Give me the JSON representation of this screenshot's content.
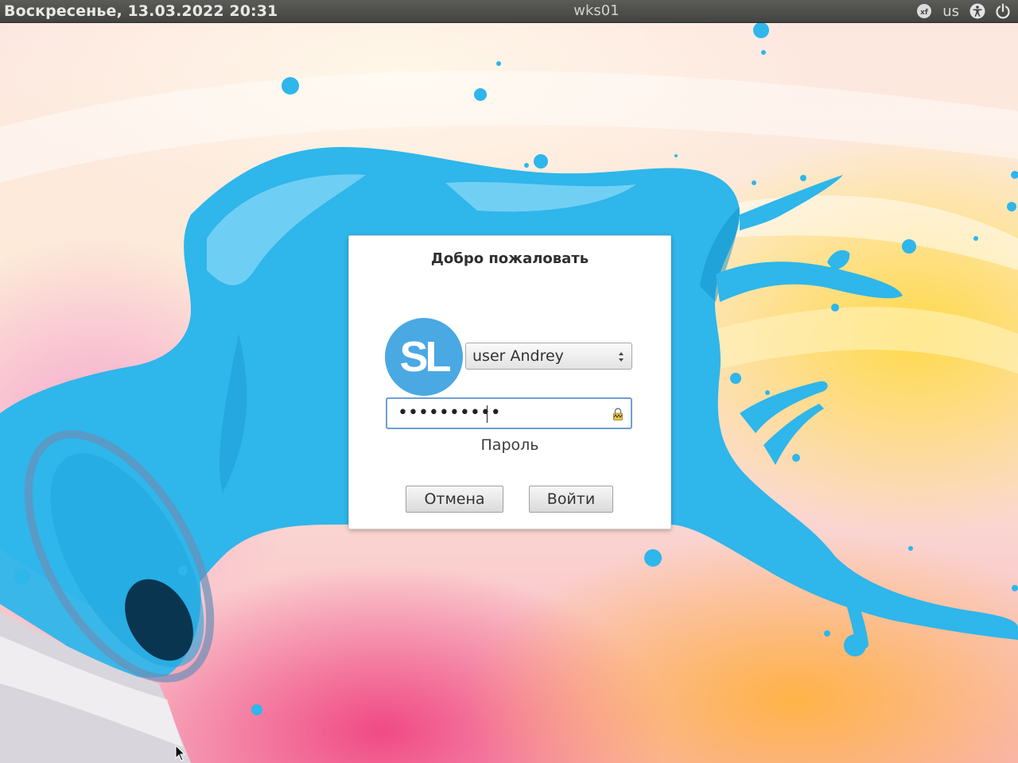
{
  "top_panel": {
    "clock": "Воскресенье, 13.03.2022 20:31",
    "hostname": "wks01",
    "tray": {
      "indicator_icon": "xf-badge-icon",
      "keyboard_layout": "us",
      "accessibility_icon": "accessibility-icon",
      "power_icon": "power-icon"
    }
  },
  "dialog": {
    "title": "Добро пожаловать",
    "avatar_text": "SL",
    "user_select": {
      "selected": "user Andrey"
    },
    "password": {
      "masked_value": "••••••••••",
      "label": "Пароль"
    },
    "buttons": {
      "cancel": "Отмена",
      "login": "Войти"
    }
  },
  "colors": {
    "accent_blue": "#4aa8e3",
    "paint_blue": "#2fb2e8",
    "panel_bg": "#4a4a48",
    "focus_border": "#6e9ed8"
  }
}
